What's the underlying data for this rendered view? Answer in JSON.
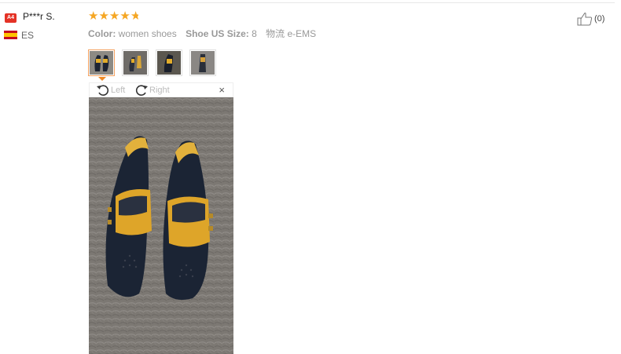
{
  "review": {
    "badge": "A4",
    "user_name": "P***r S.",
    "country": "ES",
    "rating": 4.5,
    "attributes": [
      {
        "label": "Color:",
        "value": "women shoes"
      },
      {
        "label": "Shoe US Size:",
        "value": "8"
      },
      {
        "label": "物流",
        "value": "e-EMS"
      }
    ],
    "like_count": "(0)"
  },
  "viewer": {
    "left_label": "Left",
    "right_label": "Right",
    "close_glyph": "×"
  },
  "icons": {
    "like": "thumbs-up-icon",
    "rotate_left": "rotate-left-icon",
    "rotate_right": "rotate-right-icon",
    "close": "close-icon"
  },
  "colors": {
    "star": "#f5a623",
    "badge": "#e43226",
    "active_border": "#f4a261"
  }
}
